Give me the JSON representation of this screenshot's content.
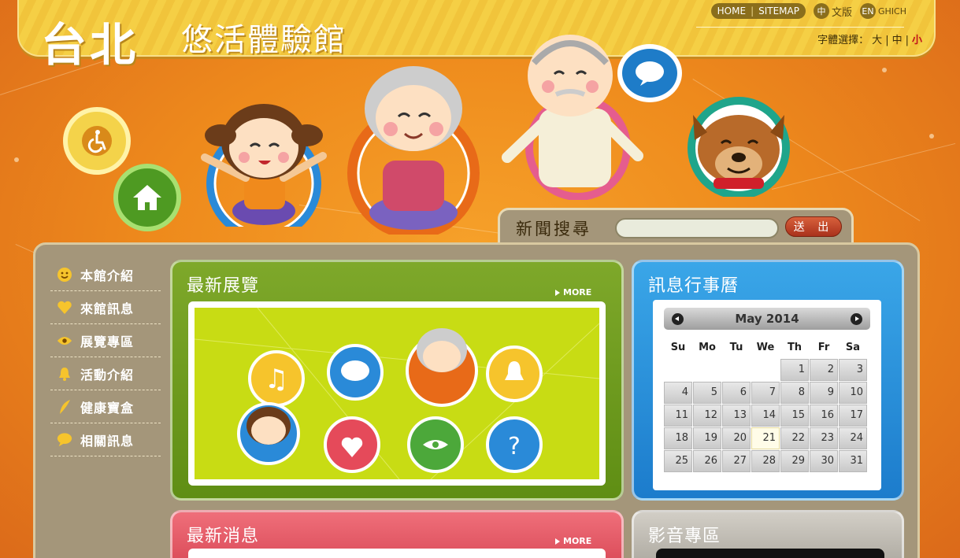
{
  "site": {
    "logo_main": "台北",
    "logo_sub": "悠活體驗館"
  },
  "topnav": {
    "home": "HOME",
    "sitemap": "SITEMAP",
    "lang_zh_badge": "中",
    "lang_zh_label": "文版",
    "lang_en_badge": "EN",
    "lang_en_label": "GHICH"
  },
  "font_size": {
    "label": "字體選擇：",
    "large": "大",
    "medium": "中",
    "small": "小",
    "sep": "|"
  },
  "search": {
    "label": "新聞搜尋",
    "value": "",
    "placeholder": "",
    "button": "送 出"
  },
  "menu": {
    "items": [
      {
        "label": "本館介紹",
        "icon": "smile-icon"
      },
      {
        "label": "來館訊息",
        "icon": "heart-icon"
      },
      {
        "label": "展覽專區",
        "icon": "eye-icon"
      },
      {
        "label": "活動介紹",
        "icon": "bell-icon"
      },
      {
        "label": "健康寶盒",
        "icon": "leaf-icon"
      },
      {
        "label": "相關訊息",
        "icon": "speech-bubble-icon"
      }
    ]
  },
  "exhibition": {
    "title": "最新展覽",
    "more": "MORE"
  },
  "calendar": {
    "title": "訊息行事曆",
    "month_label": "May 2014",
    "weekdays": [
      "Su",
      "Mo",
      "Tu",
      "We",
      "Th",
      "Fr",
      "Sa"
    ],
    "days": [
      "",
      "",
      "",
      "",
      "1",
      "2",
      "3",
      "4",
      "5",
      "6",
      "7",
      "8",
      "9",
      "10",
      "11",
      "12",
      "13",
      "14",
      "15",
      "16",
      "17",
      "18",
      "19",
      "20",
      "21",
      "22",
      "23",
      "24",
      "25",
      "26",
      "27",
      "28",
      "29",
      "30",
      "31"
    ],
    "today": "21"
  },
  "news": {
    "title": "最新消息",
    "more": "MORE"
  },
  "media": {
    "title": "影音專區"
  },
  "colors": {
    "banner": "#f3c940",
    "exhibition": "#6f9a1e",
    "calendar": "#2690da",
    "news": "#e45764",
    "media": "#c0bcb3",
    "panel": "#a4967a"
  }
}
